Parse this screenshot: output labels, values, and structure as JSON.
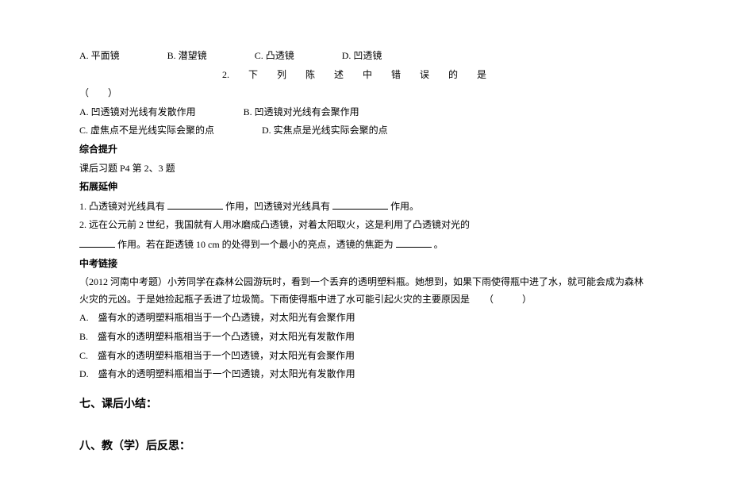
{
  "q1_options": {
    "a": "A. 平面镜",
    "b": "B. 潜望镜",
    "c": "C. 凸透镜",
    "d": "D. 凹透镜"
  },
  "q2_spaced": "2.　　下　　列　　陈　　述　　中　　错　　误　　的　　是",
  "q2_paren": "（　　）",
  "q2_options": {
    "a": "A. 凹透镜对光线有发散作用",
    "b": "B. 凹透镜对光线有会聚作用",
    "c": "C. 虚焦点不是光线实际会聚的点",
    "d": "D. 实焦点是光线实际会聚的点"
  },
  "headers": {
    "comprehensive": "综合提升",
    "comprehensive_text": "课后习题 P4 第 2、3 题",
    "extension": "拓展延伸",
    "zhongkao": "中考链接",
    "seven": "七、课后小结：",
    "eight": "八、教（学）后反思："
  },
  "extension": {
    "q1_part1": "1. 凸透镜对光线具有",
    "q1_part2": "作用，凹透镜对光线具有",
    "q1_part3": "作用。",
    "q2_part1": "2. 远在公元前 2 世纪，我国就有人用冰磨成凸透镜，对着太阳取火，这是利用了凸透镜对光的",
    "q2_part2": "作用。若在距透镜 10 cm 的处得到一个最小的亮点，透镜的焦距为",
    "q2_part3": "。"
  },
  "zhongkao": {
    "intro": "（2012 河南中考题）小芳同学在森林公园游玩时，看到一个丢弃的透明塑料瓶。她想到，如果下雨使得瓶中进了水，就可能会成为森林火灾的元凶。于是她捡起瓶子丢进了垃圾筒。下雨使得瓶中进了水可能引起火灾的主要原因是　　（　　　）",
    "a": "A.　盛有水的透明塑料瓶相当于一个凸透镜，对太阳光有会聚作用",
    "b": "B.　盛有水的透明塑料瓶相当于一个凸透镜，对太阳光有发散作用",
    "c": "C.　盛有水的透明塑料瓶相当于一个凹透镜，对太阳光有会聚作用",
    "d": "D.　盛有水的透明塑料瓶相当于一个凹透镜，对太阳光有发散作用"
  }
}
